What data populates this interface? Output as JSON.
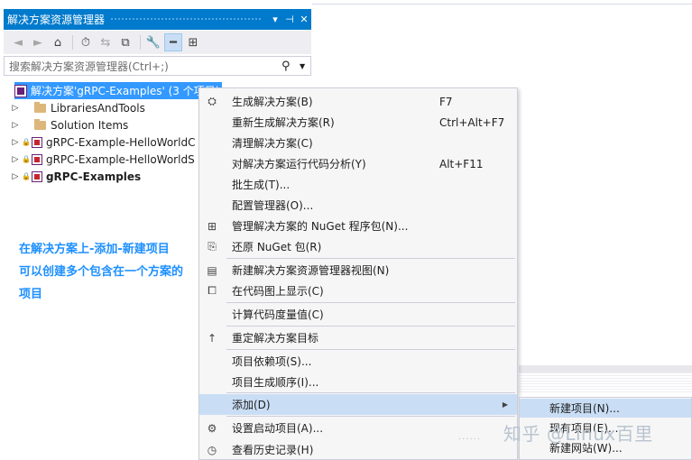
{
  "panel": {
    "title": "解决方案资源管理器",
    "title_buttons": [
      "▾",
      "⊣",
      "✕"
    ],
    "search_placeholder": "搜索解决方案资源管理器(Ctrl+;)"
  },
  "tree": {
    "solution": "解决方案'gRPC-Examples' (3 个项目)",
    "items": [
      {
        "label": "LibrariesAndTools",
        "kind": "folder"
      },
      {
        "label": "Solution Items",
        "kind": "folder"
      },
      {
        "label": "gRPC-Example-HelloWorldC",
        "kind": "project"
      },
      {
        "label": "gRPC-Example-HelloWorldS",
        "kind": "project"
      },
      {
        "label": "gRPC-Examples",
        "kind": "project",
        "bold": true
      }
    ]
  },
  "annotation": {
    "lines": [
      "在解决方案上-添加-新建项目",
      "可以创建多个包含在一个方案的",
      "项目"
    ]
  },
  "menu": {
    "items": [
      {
        "label": "生成解决方案(B)",
        "shortcut": "F7",
        "icon": "build-icon"
      },
      {
        "label": "重新生成解决方案(R)",
        "shortcut": "Ctrl+Alt+F7"
      },
      {
        "label": "清理解决方案(C)",
        "shortcut": ""
      },
      {
        "label": "对解决方案运行代码分析(Y)",
        "shortcut": "Alt+F11"
      },
      {
        "label": "批生成(T)...",
        "shortcut": ""
      },
      {
        "label": "配置管理器(O)...",
        "shortcut": ""
      },
      {
        "label": "管理解决方案的 NuGet 程序包(N)...",
        "shortcut": "",
        "icon": "nuget-icon"
      },
      {
        "label": "还原 NuGet 包(R)",
        "shortcut": "",
        "icon": "restore-icon"
      },
      {
        "label": "新建解决方案资源管理器视图(N)",
        "shortcut": "",
        "icon": "new-view-icon"
      },
      {
        "label": "在代码图上显示(C)",
        "shortcut": "",
        "icon": "code-map-icon"
      },
      {
        "label": "计算代码度量值(C)",
        "shortcut": ""
      },
      {
        "label": "重定解决方案目标",
        "shortcut": "",
        "icon": "arrow-up-icon"
      },
      {
        "label": "项目依赖项(S)...",
        "shortcut": ""
      },
      {
        "label": "项目生成顺序(I)...",
        "shortcut": ""
      },
      {
        "label": "添加(D)",
        "shortcut": "",
        "submenu": true
      },
      {
        "label": "设置启动项目(A)...",
        "shortcut": "",
        "icon": "gear-icon"
      },
      {
        "label": "查看历史记录(H)",
        "shortcut": "",
        "icon": "history-icon"
      }
    ]
  },
  "submenu": {
    "items": [
      "新建项目(N)...",
      "现有项目(E)...",
      "新建网站(W)..."
    ]
  },
  "watermark": "知乎 @Linux百里"
}
